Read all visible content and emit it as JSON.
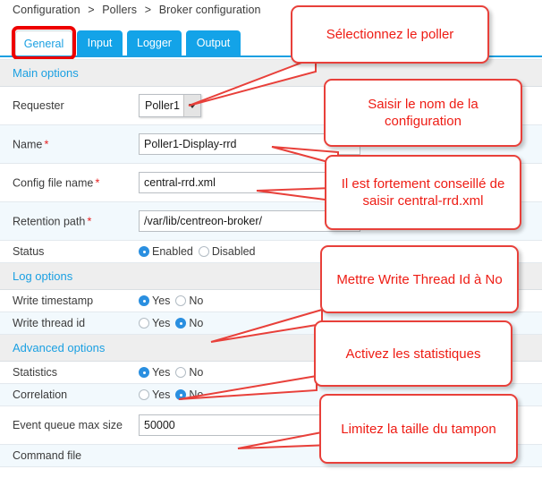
{
  "breadcrumb": {
    "items": [
      "Configuration",
      "Pollers",
      "Broker configuration"
    ],
    "separator": ">"
  },
  "tabs": [
    {
      "label": "General",
      "active": true
    },
    {
      "label": "Input",
      "active": false
    },
    {
      "label": "Logger",
      "active": false
    },
    {
      "label": "Output",
      "active": false
    }
  ],
  "sections": {
    "main": "Main options",
    "log": "Log options",
    "advanced": "Advanced options"
  },
  "fields": {
    "requester": {
      "label": "Requester",
      "value": "Poller1"
    },
    "name": {
      "label": "Name",
      "required_marker": "*",
      "value": "Poller1-Display-rrd"
    },
    "config_file_name": {
      "label": "Config file name",
      "required_marker": "*",
      "value": "central-rrd.xml"
    },
    "retention_path": {
      "label": "Retention path",
      "required_marker": "*",
      "value": "/var/lib/centreon-broker/"
    },
    "status": {
      "label": "Status",
      "options": [
        "Enabled",
        "Disabled"
      ],
      "selected": "Enabled"
    },
    "write_timestamp": {
      "label": "Write timestamp",
      "options": [
        "Yes",
        "No"
      ],
      "selected": "Yes"
    },
    "write_thread_id": {
      "label": "Write thread id",
      "options": [
        "Yes",
        "No"
      ],
      "selected": "No"
    },
    "statistics": {
      "label": "Statistics",
      "options": [
        "Yes",
        "No"
      ],
      "selected": "Yes"
    },
    "correlation": {
      "label": "Correlation",
      "options": [
        "Yes",
        "No"
      ],
      "selected": "No"
    },
    "event_queue_max_size": {
      "label": "Event queue max size",
      "value": "50000"
    },
    "command_file": {
      "label": "Command file",
      "value": ""
    }
  },
  "annotations": [
    {
      "id": "select-poller",
      "text": "Sélectionnez le poller"
    },
    {
      "id": "enter-config-name",
      "text": "Saisir le nom de la configuration"
    },
    {
      "id": "recommend-central-rrd",
      "text": "Il est fortement conseillé de saisir central-rrd.xml"
    },
    {
      "id": "write-thread-id-no",
      "text": "Mettre Write Thread Id à No"
    },
    {
      "id": "enable-statistics",
      "text": "Activez les statistiques"
    },
    {
      "id": "limit-buffer-size",
      "text": "Limitez la taille du tampon"
    }
  ],
  "colors": {
    "tab_blue": "#13a3e8",
    "link_blue": "#1ba0e2",
    "annotation_red": "#ee1c14",
    "highlight_red": "#ee0000",
    "radio_blue": "#2a8fe0"
  }
}
